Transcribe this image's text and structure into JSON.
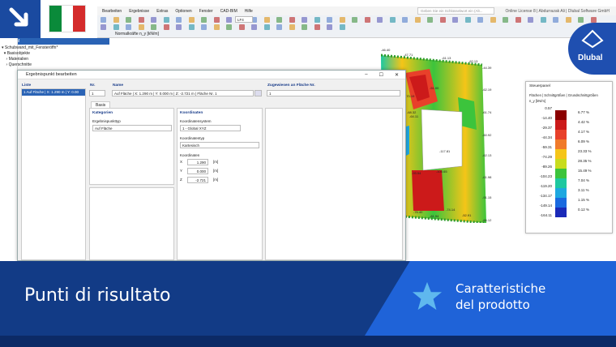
{
  "menu": {
    "items": [
      "Bearbeiten",
      "Ergebnisse",
      "Extras",
      "Optionen",
      "Fenster",
      "CAD-BIM",
      "Hilfe"
    ],
    "license": "Online License 8 | Abdurrazak Ali | Dlubal Software GmbH",
    "search_placeholder": "Geben Sie ein Schlüsselwort ein (Alt..."
  },
  "toolbar": {
    "loadcase": "LF4",
    "result_label": "Normalkräfte n_y [kN/m]"
  },
  "navigator": {
    "title": "RFEM",
    "tree": [
      "Schubwand_mit_Fensteröffn*",
      "Basisobjekte",
      "Materialien",
      "Querschnitte"
    ]
  },
  "dialog": {
    "title": "Ergebnispunkt bearbeiten",
    "list_header": "Liste",
    "list_item": "1  Auf Fläche | X: 1.290 m | Y: 0.00",
    "no_header": "Nr.",
    "no_value": "1",
    "name_header": "Name",
    "name_value": "Auf Fläche | X: 1.290 m | Y: 0.000 m | Z: -2.721 m | Fläche Nr. 1",
    "assign_header": "Zugewiesen an Fläche Nr.",
    "assign_value": "1",
    "tab": "Basis",
    "categories_header": "Kategorien",
    "type_label": "Ergebnispunkttyp",
    "type_value": "Auf Fläche",
    "coords_header": "Koordinaten",
    "cs_label": "Koordinatensystem",
    "cs_value": "1 - Global XYZ",
    "ct_label": "Koordinatentyp",
    "ct_value": "Kartesisch",
    "coords_label": "Koordinaten",
    "x_label": "X",
    "x_value": "1.290",
    "y_label": "Y",
    "y_value": "0.000",
    "z_label": "Z",
    "z_value": "-2.721",
    "unit": "[m]"
  },
  "legend": {
    "title": "Steuerpanel",
    "subtitle": "Flächen | Schnittgrößen | Grundschnittgrößen",
    "unit": "n_y [kN/m]",
    "values": [
      "0.57",
      "-14.40",
      "-29.37",
      "-44.34",
      "-59.31",
      "-74.29",
      "-89.26",
      "-104.23",
      "-119.20",
      "-134.17",
      "-149.14",
      "-164.11"
    ],
    "percents": [
      "6.77 %",
      "4.42 %",
      "4.17 %",
      "6.09 %",
      "23.33 %",
      "28.35 %",
      "15.49 %",
      "7.04 %",
      "3.11 %",
      "1.15 %",
      "0.12 %"
    ],
    "colors": [
      "#8b0000",
      "#cc1a1a",
      "#e8402a",
      "#f07a2a",
      "#f5c518",
      "#c8dc1e",
      "#3cc43c",
      "#1ec8a0",
      "#1ea8e0",
      "#1a6ae0",
      "#1a2ab8"
    ]
  },
  "model_labels": [
    "-46.40",
    "-47.71",
    "-61.13",
    "-62.13",
    "-44.39",
    "-62.19",
    "-51.00",
    "-61.74",
    "-60.92",
    "-70.19",
    "-68.32",
    "-64.11",
    "-117.81",
    "-100.65",
    "-62.13",
    "-61.98",
    "-91.15",
    "-70.24",
    "-74.14",
    "-66.12",
    "-76.40",
    "-81.94",
    "-52.91",
    "-93.54"
  ],
  "banner": {
    "title": "Punti di risultato",
    "feature_line1": "Caratteristiche",
    "feature_line2": "del prodotto",
    "brand": "Dlubal"
  },
  "flag_colors": [
    "#0a8a3a",
    "#ffffff",
    "#d42b2b"
  ]
}
